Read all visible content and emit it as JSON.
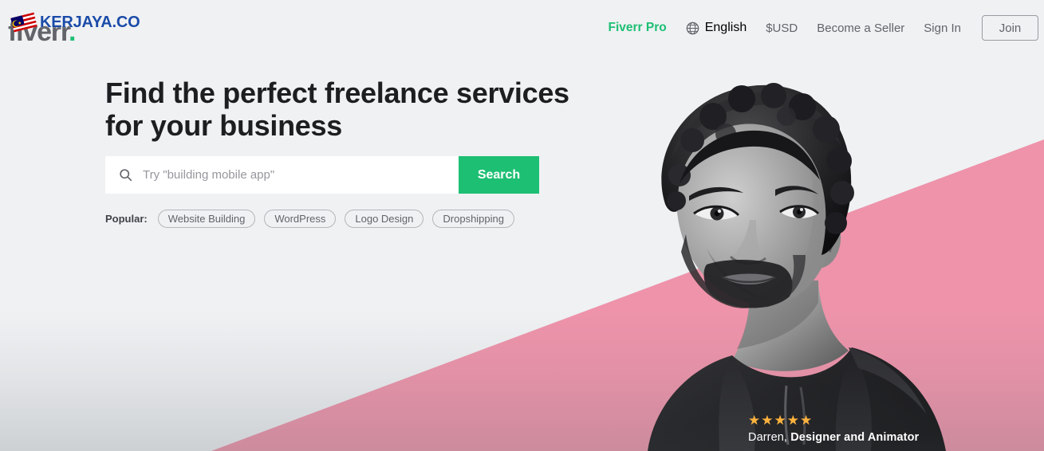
{
  "brand": {
    "logo_text": "fiverr",
    "logo_dot": ".",
    "watermark_text": "KERJAYA.CO",
    "flag_icon": "malaysia-flag-icon",
    "accent_green": "#1DBF73",
    "watermark_blue": "#1B4BA8",
    "pink": "#EE93AA",
    "page_bg": "#EFF1F3"
  },
  "nav": {
    "pro_label": "Fiverr Pro",
    "globe_icon": "globe-icon",
    "language": "English",
    "currency": "$USD",
    "become_seller": "Become a Seller",
    "sign_in": "Sign In",
    "join": "Join"
  },
  "hero": {
    "headline_line1": "Find the perfect freelance services",
    "headline_line2": "for your business"
  },
  "search": {
    "icon": "search-icon",
    "placeholder": "Try \"building mobile app\"",
    "value": "",
    "button_label": "Search"
  },
  "popular": {
    "label": "Popular:",
    "tags": [
      {
        "label": "Website Building"
      },
      {
        "label": "WordPress"
      },
      {
        "label": "Logo Design"
      },
      {
        "label": "Dropshipping"
      }
    ]
  },
  "testimonial": {
    "stars": "★★★★★",
    "rating": 5,
    "name": "Darren,",
    "role": "Designer and Animator",
    "star_color": "#FFB33E"
  }
}
